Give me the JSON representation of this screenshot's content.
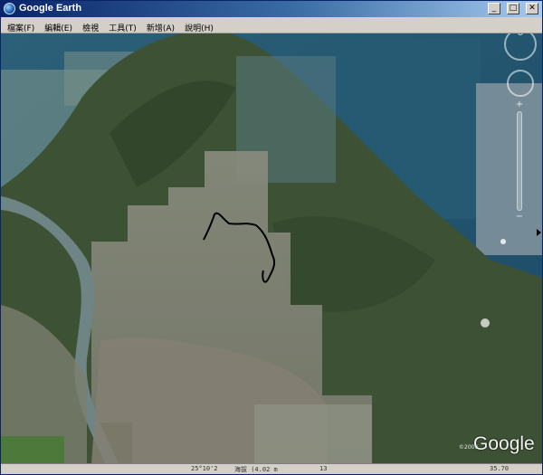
{
  "window": {
    "title": "Google Earth",
    "icon": "google-earth-globe-icon",
    "controls": {
      "minimize": "_",
      "maximize": "□",
      "close": "✕"
    }
  },
  "menu": [
    {
      "label": "檔案(F)"
    },
    {
      "label": "編輯(E)"
    },
    {
      "label": "檢視"
    },
    {
      "label": "工具(T)"
    },
    {
      "label": "新增(A)"
    },
    {
      "label": "說明(H)"
    }
  ],
  "map": {
    "overlay_track_color": "#000000",
    "logo": "Google",
    "copyright": "©2008"
  },
  "status": {
    "lat": "25°10'2",
    "elev": "海拔 (4.02 m",
    "view": "13",
    "eye": "35.70"
  },
  "colors": {
    "titlebar_start": "#0a246a",
    "titlebar_end": "#a6caf0",
    "sea": "#1e4f6e",
    "land": "#3d5234"
  }
}
